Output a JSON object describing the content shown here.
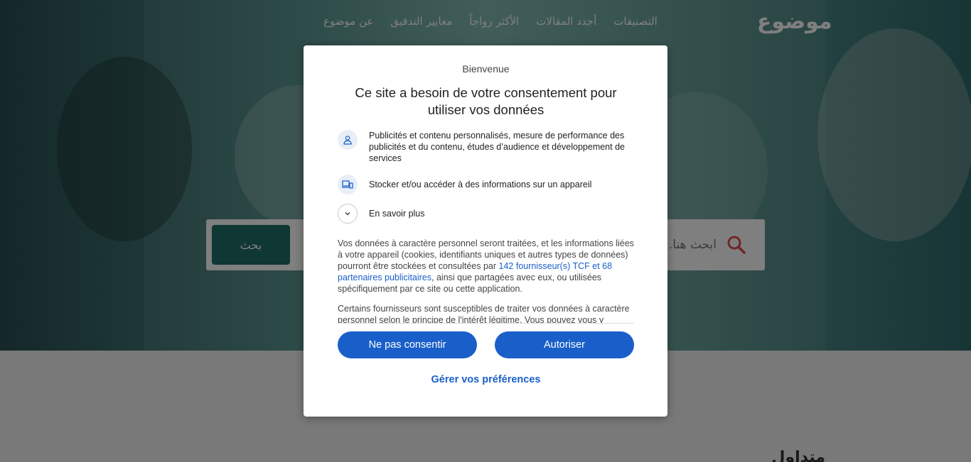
{
  "site": {
    "logo": "موضوع",
    "nav": [
      "التصنيفات",
      "أجدد المقالات",
      "الأكثر رواجاً",
      "معايير التدقيق",
      "عن موضوع"
    ],
    "search": {
      "placeholder": "ابحث هنا...",
      "button": "بحث"
    },
    "section_heading": "متداول"
  },
  "consent": {
    "welcome": "Bienvenue",
    "title": "Ce site a besoin de votre consentement pour utiliser vos données",
    "purposes": [
      {
        "icon": "person-icon",
        "text": "Publicités et contenu personnalisés, mesure de performance des publicités et du contenu, études d’audience et développement de services"
      },
      {
        "icon": "devices-icon",
        "text": "Stocker et/ou accéder à des informations sur un appareil"
      },
      {
        "icon": "chevron-down-icon",
        "text": "En savoir plus"
      }
    ],
    "body_p1_before": "Vos données à caractère personnel seront traitées, et les informations liées à votre appareil (cookies, identifiants uniques et autres types de données) pourront être stockées et consultées par ",
    "body_p1_link": "142 fournisseur(s) TCF et 68 partenaires publicitaires",
    "body_p1_after": ", ainsi que partagées avec eux, ou utilisées spécifiquement par ce site ou cette application.",
    "body_p2": "Certains fournisseurs sont susceptibles de traiter vos données à caractère personnel selon le principe de l'intérêt légitime. Vous pouvez vous y",
    "decline": "Ne pas consentir",
    "accept": "Autoriser",
    "manage": "Gérer vos préférences"
  },
  "colors": {
    "accent": "#1a5fc9",
    "search_button": "#1f6e69"
  }
}
